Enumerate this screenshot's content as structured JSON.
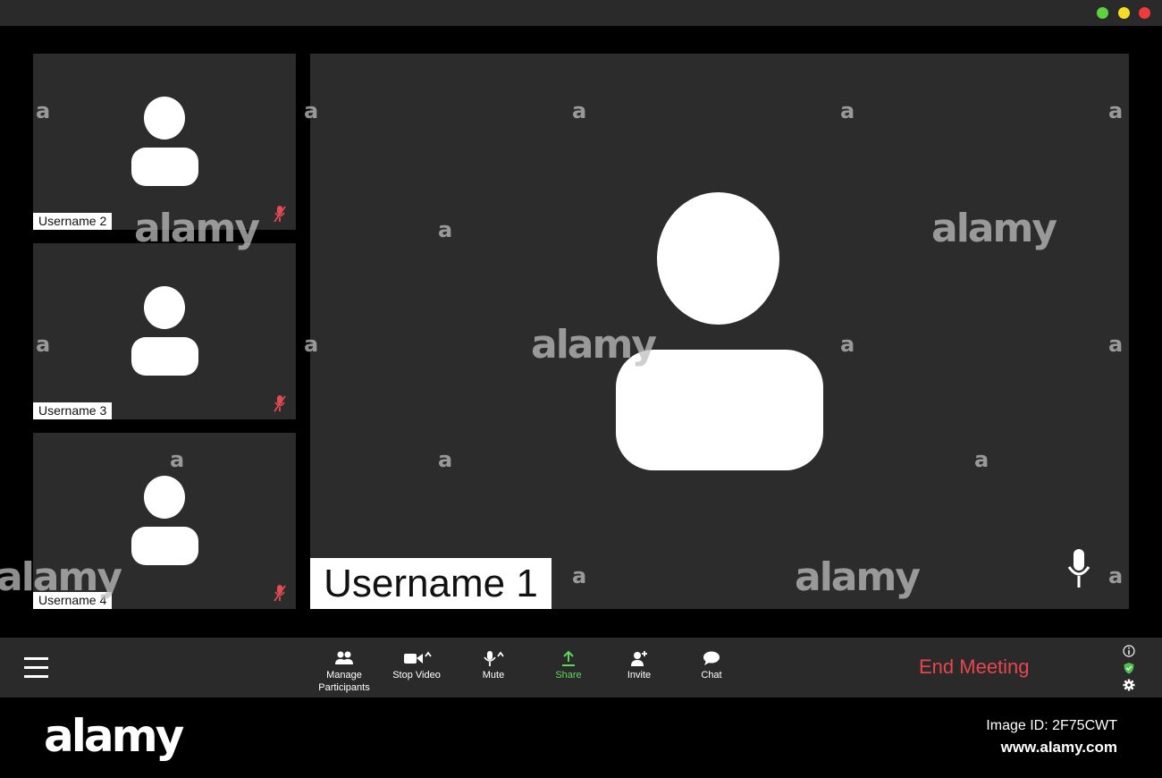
{
  "window": {
    "traffic_lights": {
      "green": "#5fd13f",
      "yellow": "#f5dd27",
      "red": "#ef3b3b"
    }
  },
  "participants": {
    "main": {
      "name": "Username 1",
      "icon": "mic-icon"
    },
    "thumbnails": [
      {
        "name": "Username 2",
        "icon": "mic-muted-icon"
      },
      {
        "name": "Username 3",
        "icon": "mic-muted-icon"
      },
      {
        "name": "Username 4",
        "icon": "mic-muted-icon"
      }
    ]
  },
  "toolbar": {
    "menu_icon": "hamburger-icon",
    "manage_participants": "Manage\nParticipants",
    "stop_video": "Stop Video",
    "mute": "Mute",
    "share": "Share",
    "invite": "Invite",
    "chat": "Chat",
    "end_meeting": "End Meeting",
    "side_icons": [
      "info-icon",
      "shield-icon",
      "gear-icon"
    ]
  },
  "colors": {
    "tile_bg": "#2c2c2c",
    "toolbar_bg": "#2a2a2a",
    "end_meeting": "#e8464e",
    "share_green": "#5dd85d",
    "muted_mic": "#e04b55",
    "shield_green": "#4ec24e"
  },
  "watermark": {
    "brand": "alamy",
    "letter": "a",
    "image_id": "Image ID: 2F75CWT",
    "url": "www.alamy.com"
  }
}
